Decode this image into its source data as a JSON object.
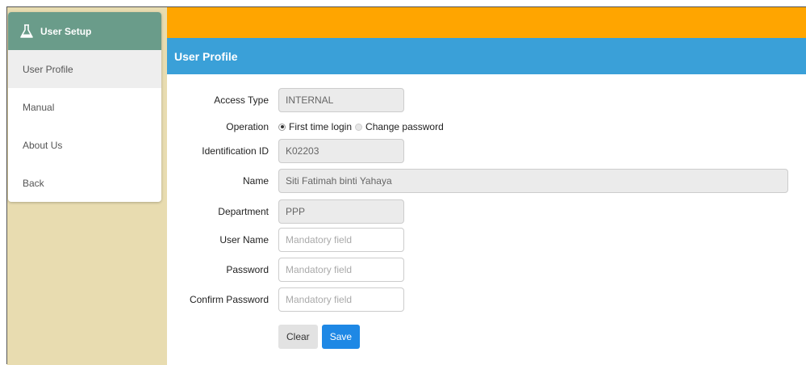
{
  "sidebar": {
    "header": "User Setup",
    "header_icon": "flask-icon",
    "items": [
      {
        "label": "User Profile",
        "active": true
      },
      {
        "label": "Manual"
      },
      {
        "label": "About Us"
      },
      {
        "label": "Back"
      }
    ]
  },
  "page_title": "User Profile",
  "colors": {
    "topbar": "#ffa500",
    "titlebar": "#3aa0d8",
    "sidebar_header": "#6a9c8a",
    "sidebar_bg": "#e8dcb0",
    "save_button": "#1e88e5"
  },
  "form": {
    "access_type": {
      "label": "Access Type",
      "value": "INTERNAL"
    },
    "operation": {
      "label": "Operation",
      "options": [
        "First time login",
        "Change password"
      ],
      "selected": "First time login"
    },
    "identification_id": {
      "label": "Identification ID",
      "value": "K02203"
    },
    "name": {
      "label": "Name",
      "value": "Siti Fatimah binti Yahaya"
    },
    "department": {
      "label": "Department",
      "value": "PPP"
    },
    "username": {
      "label": "User Name",
      "placeholder": "Mandatory field"
    },
    "password": {
      "label": "Password",
      "placeholder": "Mandatory field"
    },
    "confirm_password": {
      "label": "Confirm Password",
      "placeholder": "Mandatory field"
    }
  },
  "buttons": {
    "clear": "Clear",
    "save": "Save"
  }
}
